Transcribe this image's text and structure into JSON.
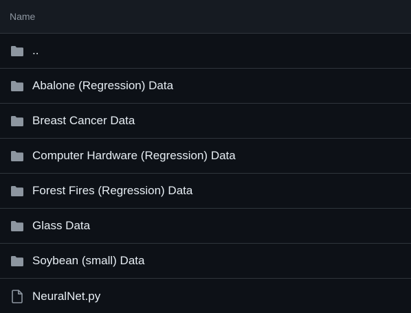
{
  "table": {
    "header_label": "Name",
    "rows": [
      {
        "label": "..",
        "icon": "folder-icon"
      },
      {
        "label": "Abalone (Regression) Data",
        "icon": "folder-icon"
      },
      {
        "label": "Breast Cancer Data",
        "icon": "folder-icon"
      },
      {
        "label": "Computer Hardware (Regression) Data",
        "icon": "folder-icon"
      },
      {
        "label": "Forest Fires (Regression) Data",
        "icon": "folder-icon"
      },
      {
        "label": "Glass Data",
        "icon": "folder-icon"
      },
      {
        "label": "Soybean (small) Data",
        "icon": "folder-icon"
      },
      {
        "label": "NeuralNet.py",
        "icon": "file-icon"
      }
    ]
  },
  "colors": {
    "background": "#0d1117",
    "header_background": "#161b22",
    "border": "#30363d",
    "icon": "#8d96a0",
    "text": "#e6edf3",
    "muted_text": "#8d96a0"
  }
}
